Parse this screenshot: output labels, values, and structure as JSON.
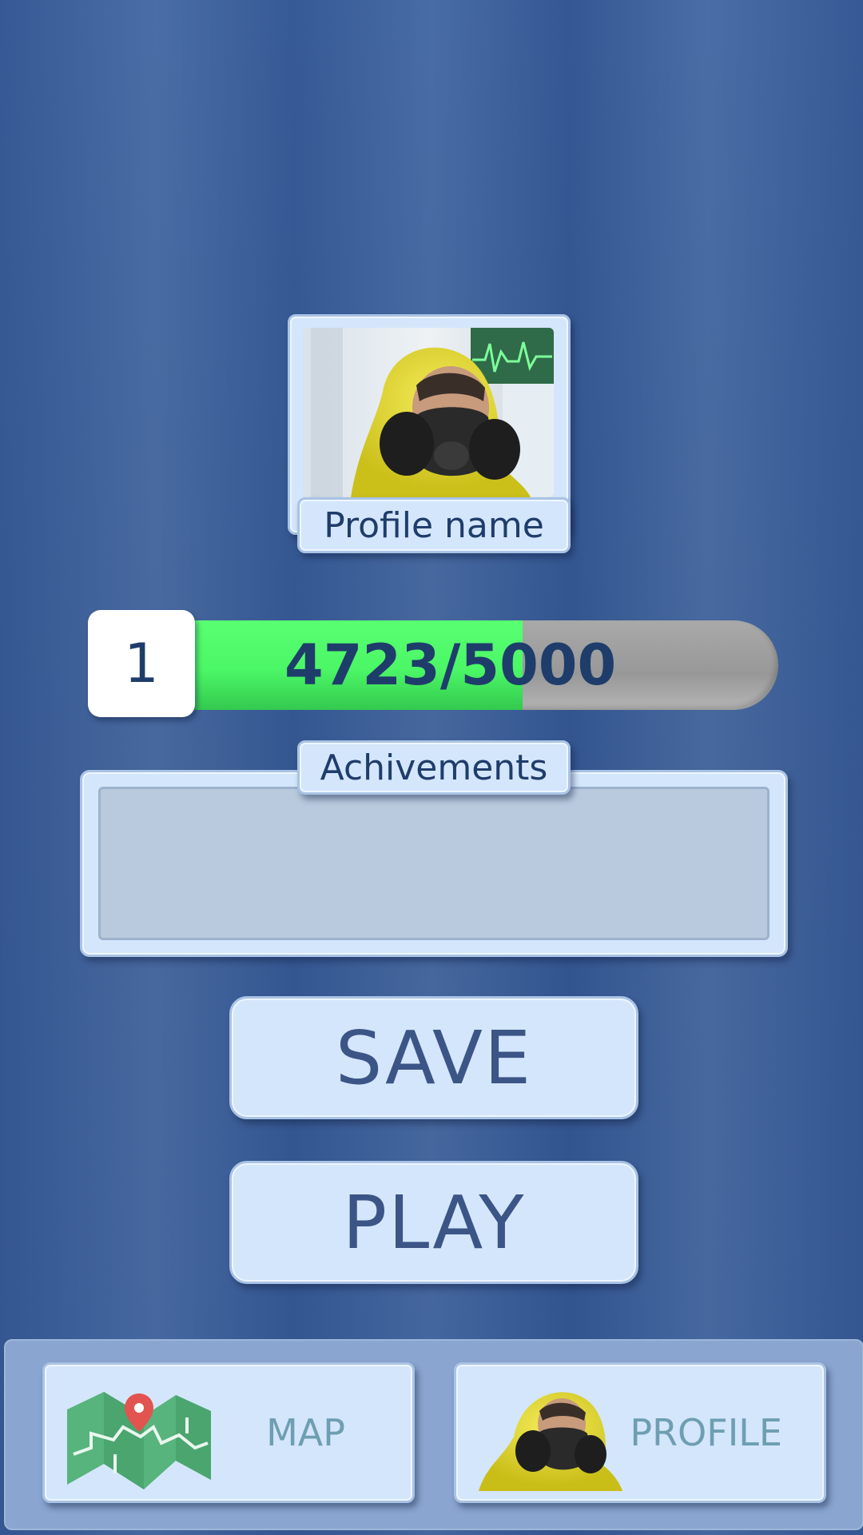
{
  "profile": {
    "name": "Profile name",
    "avatar_icon": "hazmat-suit-avatar"
  },
  "progress": {
    "level": "1",
    "xp_text": "4723/5000",
    "xp_current": 4723,
    "xp_max": 5000,
    "fill_color": "#4bf766",
    "track_color": "#9c9c9c"
  },
  "achievements": {
    "label": "Achivements"
  },
  "buttons": {
    "save_label": "SAVE",
    "play_label": "PLAY"
  },
  "nav": {
    "map_label": "MAP",
    "map_icon": "map-pin-icon",
    "profile_label": "PROFILE",
    "profile_icon": "hazmat-avatar-icon"
  }
}
